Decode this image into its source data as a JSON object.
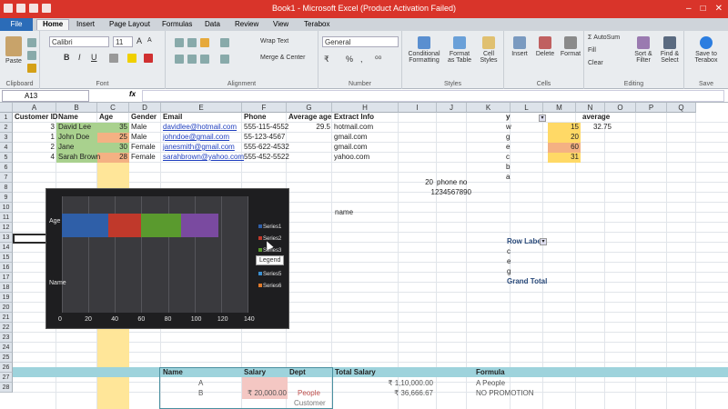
{
  "window": {
    "title": "Book1 - Microsoft Excel (Product Activation Failed)",
    "controls": [
      "–",
      "□",
      "✕"
    ]
  },
  "tabs": [
    "File",
    "Home",
    "Insert",
    "Page Layout",
    "Formulas",
    "Data",
    "Review",
    "View",
    "Terabox"
  ],
  "ribbon": {
    "clipboard": {
      "label": "Clipboard",
      "paste": "Paste"
    },
    "font": {
      "label": "Font",
      "name": "Calibri",
      "size": "11",
      "bold": "B",
      "italic": "I",
      "underline": "U",
      "grow": "A",
      "shrink": "A"
    },
    "alignment": {
      "label": "Alignment",
      "wrap": "Wrap Text",
      "merge": "Merge & Center"
    },
    "number": {
      "label": "Number",
      "format": "General",
      "currency": "%",
      "comma": ",",
      "dec1": "₹",
      "dec2": "⁰⁰"
    },
    "styles": {
      "label": "Styles",
      "cond": "Conditional Formatting",
      "table": "Format as Table",
      "cell": "Cell Styles"
    },
    "cells": {
      "label": "Cells",
      "insert": "Insert",
      "delete": "Delete",
      "format": "Format"
    },
    "editing": {
      "label": "Editing",
      "autosum": "AutoSum",
      "fill": "Fill",
      "clear": "Clear",
      "sort": "Sort & Filter",
      "find": "Find & Select"
    },
    "save": {
      "label": "Save",
      "btn": "Save to Terabox"
    }
  },
  "formula_bar": {
    "name_box": "A13",
    "fx": "fx",
    "content": ""
  },
  "columns": [
    "A",
    "B",
    "C",
    "D",
    "E",
    "F",
    "G",
    "H",
    "I",
    "J",
    "K",
    "L",
    "M",
    "N",
    "O",
    "P",
    "Q"
  ],
  "rows": [
    "1",
    "2",
    "3",
    "4",
    "5",
    "6",
    "7",
    "8",
    "9",
    "10",
    "11",
    "12",
    "13",
    "14",
    "15",
    "16",
    "17",
    "18",
    "19",
    "20",
    "21",
    "22",
    "23",
    "24",
    "25",
    "26",
    "27",
    "28"
  ],
  "sheet": {
    "headers": [
      "Customer ID",
      "Name",
      "Age",
      "Gender",
      "Email",
      "Phone",
      "Average age",
      "Extract Info"
    ],
    "records": [
      [
        "3",
        "David Lee",
        "35",
        "Male",
        "davidlee@hotmail.com",
        "555-115-4552",
        "29.5",
        "hotmail.com"
      ],
      [
        "1",
        "John Doe",
        "25",
        "Male",
        "johndoe@gmail.com",
        "55-123-4567",
        "",
        "gmail.com"
      ],
      [
        "2",
        "Jane",
        "30",
        "Female",
        "janesmith@gmail.com",
        "555-622-4532",
        "",
        "gmail.com"
      ],
      [
        "4",
        "Sarah Brown",
        "28",
        "Female",
        "sarahbrown@yahoo.com",
        "555-452-5522",
        "",
        "yahoo.com"
      ]
    ],
    "extra": {
      "i7": "20",
      "i7b": "phone no",
      "i8": "1234567890",
      "h10": "name",
      "k1": "y",
      "k2": "w",
      "k3": "g",
      "k4": "e",
      "k5": "c",
      "k6": "b",
      "k7": "a",
      "l2": "15",
      "l3": "20",
      "l4": "60",
      "l5": "31",
      "m1": "average",
      "m2": "32.75",
      "pivot_title": "Row Labels",
      "pivot_items": [
        "c",
        "e",
        "g"
      ],
      "pivot_total": "Grand Total"
    },
    "lower": {
      "headers": [
        "Name",
        "Salary",
        "Dept",
        "Total Salary",
        "Formula"
      ],
      "row27": [
        "A",
        "",
        "",
        "₹ 1,10,000.00",
        "A People"
      ],
      "row28": [
        "B",
        "₹ 20,000.00",
        "People",
        "₹ 36,666.67",
        "NO PROMOTION"
      ],
      "row29": [
        "",
        "",
        "Customer",
        "",
        ""
      ]
    }
  },
  "chart_data": {
    "type": "bar",
    "orientation": "horizontal",
    "stacked": true,
    "categories": [
      "Age",
      "Name"
    ],
    "series": [
      {
        "name": "Series1",
        "values": [
          35,
          0
        ],
        "color": "#2f5fa8"
      },
      {
        "name": "Series2",
        "values": [
          25,
          0
        ],
        "color": "#c0392b"
      },
      {
        "name": "Series3",
        "values": [
          30,
          0
        ],
        "color": "#5a9a2e"
      },
      {
        "name": "Series4",
        "values": [
          28,
          0
        ],
        "color": "#7a4aa0"
      },
      {
        "name": "Series5",
        "values": [
          0,
          0
        ],
        "color": "#3b8fd0"
      },
      {
        "name": "Series6",
        "values": [
          0,
          0
        ],
        "color": "#e07a2a"
      }
    ],
    "xticks": [
      "0",
      "20",
      "40",
      "60",
      "80",
      "100",
      "120",
      "140"
    ],
    "xlim": [
      0,
      140
    ],
    "legend_position": "right",
    "tooltip": "Legend"
  },
  "colors": {
    "titlebar": "#d9342a",
    "green_fill": "#a9d18e",
    "orange_fill": "#f4b183",
    "yellow_fill": "#ffe699",
    "teal_fill": "#9ed3dc"
  }
}
